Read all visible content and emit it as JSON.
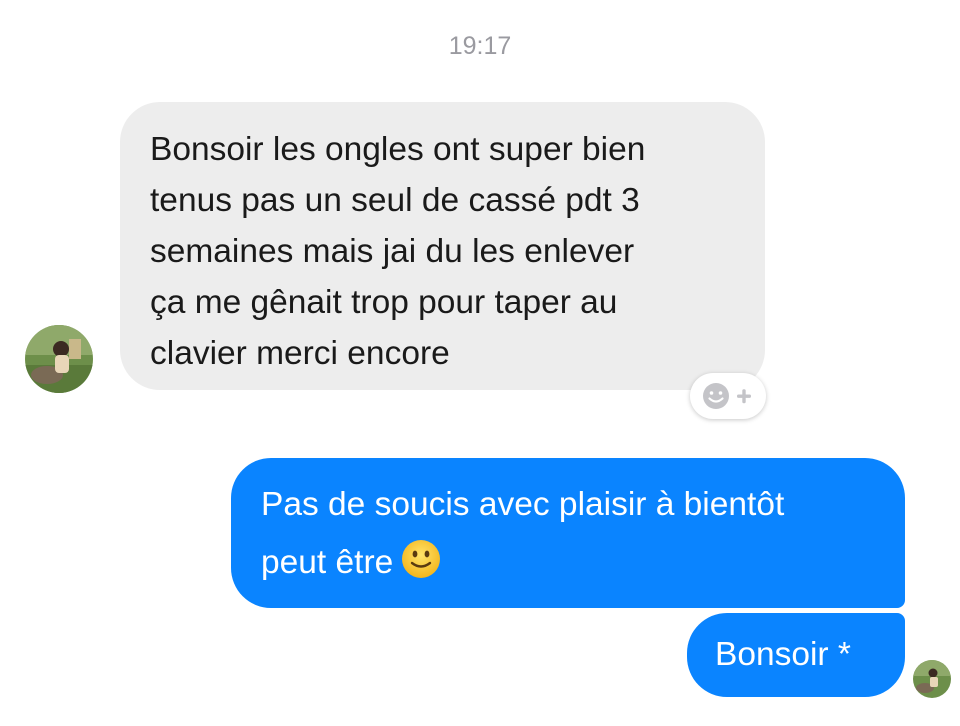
{
  "conversation": {
    "timestamp": "19:17",
    "messages": [
      {
        "direction": "incoming",
        "text": "Bonsoir les ongles ont super bien\ntenus pas un seul de cassé pdt 3\nsemaines mais jai du les enlever\nça me gênait trop pour taper au\nclavier merci encore"
      },
      {
        "direction": "outgoing",
        "text": "Pas de soucis avec plaisir à bientôt\npeut être",
        "emoji": "slightly-smiling-face-emoji"
      },
      {
        "direction": "outgoing",
        "text": "Bonsoir *"
      }
    ]
  },
  "icons": {
    "reaction": "add-reaction-icon",
    "emoji": "slightly-smiling-face-emoji"
  },
  "colors": {
    "incoming_bubble": "#ededed",
    "outgoing_bubble": "#0a84ff",
    "timestamp": "#9a9aa0"
  }
}
